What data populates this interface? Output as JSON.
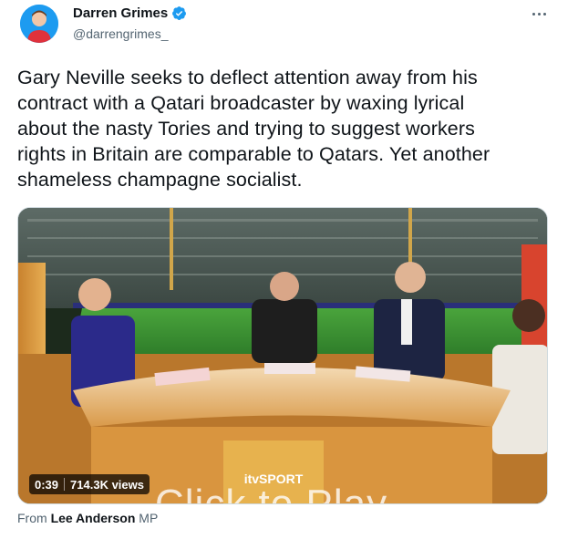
{
  "author": {
    "display_name": "Darren Grimes",
    "handle": "@darrengrimes_",
    "verified": true,
    "avatar_icon": "avatar-person-icon"
  },
  "tweet": {
    "text": "Gary Neville seeks to deflect attention away from his\ncontract with a Qatari broadcaster by waxing lyrical\nabout the nasty Tories and trying to suggest workers\nrights in Britain are comparable to Qatars. Yet another\nshameless champagne socialist."
  },
  "media": {
    "duration": "0:39",
    "views": "714.3K views",
    "desk_branding": "itvSPORT",
    "watermark": "Click to Play"
  },
  "attribution": {
    "prefix": "From",
    "source_name": "Lee Anderson",
    "suffix": "MP"
  },
  "colors": {
    "accent": "#1d9bf0",
    "text_primary": "#0f1419",
    "text_secondary": "#536471",
    "pitch_green": "#3f9a35",
    "desk_orange": "#e8a33a"
  }
}
